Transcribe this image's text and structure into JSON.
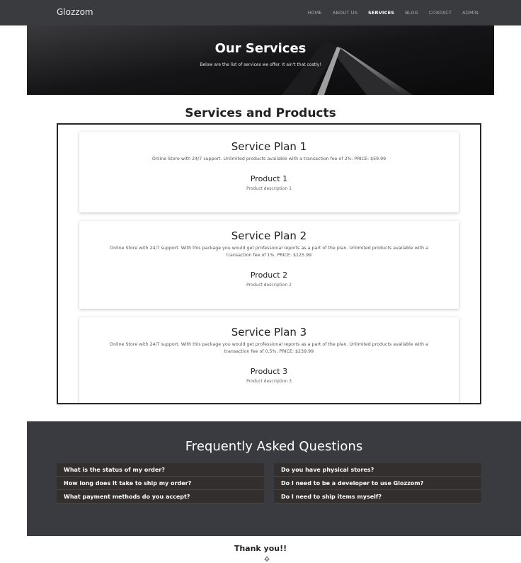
{
  "navbar": {
    "brand": "Glozzom",
    "links": [
      "HOME",
      "ABOUT US",
      "SERVICES",
      "BLOG",
      "CONTACT",
      "ADMIN"
    ],
    "active": "SERVICES"
  },
  "hero": {
    "title": "Our Services",
    "subtitle": "Below are the list of services we offer. It ain't that costly!"
  },
  "services_section": {
    "title": "Services and Products",
    "plans": [
      {
        "title": "Service Plan 1",
        "description": "Online Store with 24/7 support. Unlimited products available with a transaction fee of 2%. PRICE: $59.99",
        "product_title": "Product 1",
        "product_description": "Product description 1"
      },
      {
        "title": "Service Plan 2",
        "description": "Online Store with 24/7 support. With this package you would get professional reports as a part of the plan. Unlimited products available with a transaction fee of 1%. PRICE: $125.99",
        "product_title": "Product 2",
        "product_description": "Product description 2"
      },
      {
        "title": "Service Plan 3",
        "description": "Online Store with 24/7 support. With this package you would get professional reports as a part of the plan. Unlimited products available with a transaction fee of 0.5%. PRICE: $239.99",
        "product_title": "Product 3",
        "product_description": "Product description 3"
      }
    ]
  },
  "faq": {
    "title": "Frequently Asked Questions",
    "left": [
      "What is the status of my order?",
      "How long does it take to ship my order?",
      "What payment methods do you accept?"
    ],
    "right": [
      "Do you have physical stores?",
      "Do I need to be a developer to use Glozzom?",
      "Do I need to ship items myself?"
    ]
  },
  "footer": {
    "text": "Thank you!!",
    "icon": "up-arrow-icon"
  },
  "colors": {
    "navbar_bg": "#3a3b3f",
    "hero_bg": "#0e0e10",
    "faq_bg": "#3a3b40",
    "faq_item_bg": "#322f2e"
  }
}
